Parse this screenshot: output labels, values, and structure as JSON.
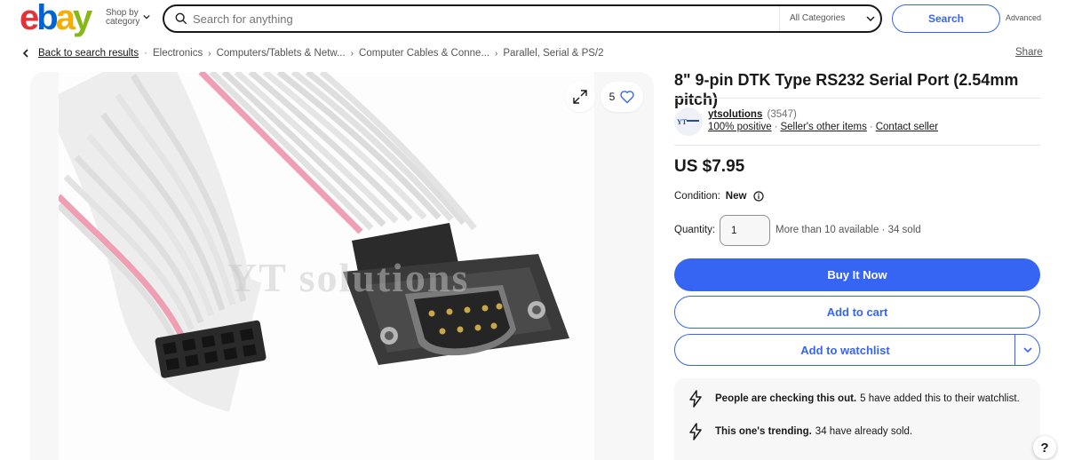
{
  "header": {
    "logo": {
      "e": "e",
      "b": "b",
      "a": "a",
      "y": "y"
    },
    "shop_by_line1": "Shop by",
    "shop_by_line2": "category",
    "search_placeholder": "Search for anything",
    "category": "All Categories",
    "search_label": "Search",
    "advanced_label": "Advanced"
  },
  "breadcrumb": {
    "back": "Back to search results",
    "items": [
      "Electronics",
      "Computers/Tablets & Netw...",
      "Computer Cables & Conne...",
      "Parallel, Serial & PS/2"
    ]
  },
  "share_label": "Share",
  "gallery": {
    "watch_count": "5",
    "watermark": "YT solutions"
  },
  "item": {
    "title": "8\" 9-pin DTK Type RS232 Serial Port (2.54mm pitch)",
    "seller": {
      "name": "ytsolutions",
      "feedback_count": "(3547)",
      "positive": "100% positive",
      "other_items": "Seller's other items",
      "contact": "Contact seller"
    },
    "price": "US $7.95",
    "condition_label": "Condition:",
    "condition_value": "New",
    "quantity_label": "Quantity:",
    "quantity_value": "1",
    "availability": "More than 10 available · 34 sold",
    "buy_now": "Buy It Now",
    "add_to_cart": "Add to cart",
    "add_to_watchlist": "Add to watchlist"
  },
  "signals": [
    {
      "bold": "People are checking this out.",
      "text": "5 have added this to their watchlist."
    },
    {
      "bold": "This one's trending.",
      "text": "34 have already sold."
    }
  ],
  "help_label": "?",
  "colors": {
    "accent": "#3665f3",
    "text": "#191919",
    "muted": "#707070"
  }
}
